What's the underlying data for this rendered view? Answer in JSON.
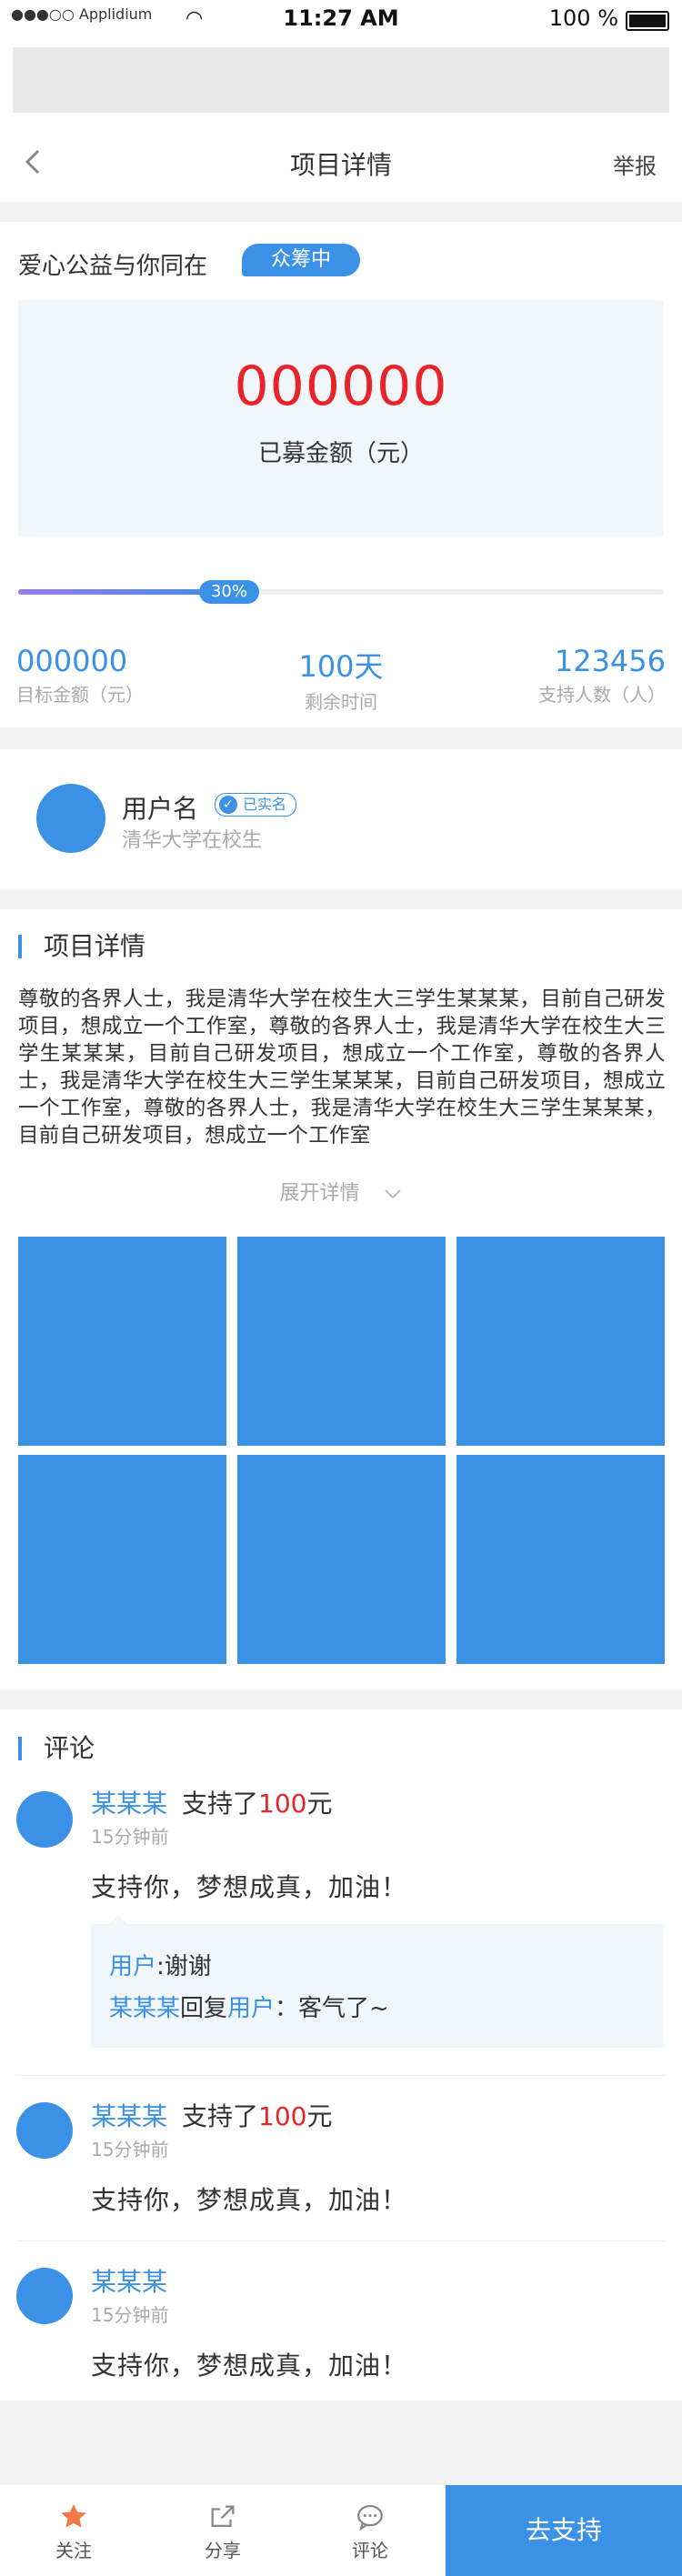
{
  "status_bar": {
    "carrier": "●●●○○ Applidium",
    "time": "11:27 AM",
    "battery": "100 %"
  },
  "nav": {
    "back_icon": "chevron-left-icon",
    "title": "项目详情",
    "report": "举报"
  },
  "project": {
    "slogan": "爱心公益与你同在",
    "status_tag": "众筹中",
    "raised_amount": "000000",
    "raised_label": "已募金额（元）",
    "progress_percent": 30,
    "progress_label": "30%",
    "stats": [
      {
        "value": "000000",
        "label": "目标金额（元）"
      },
      {
        "value": "100天",
        "label": "剩余时间"
      },
      {
        "value": "123456",
        "label": "支持人数（人）"
      }
    ]
  },
  "user": {
    "name": "用户名",
    "verified": "已实名",
    "school": "清华大学在校生"
  },
  "details": {
    "title": "项目详情",
    "text": "尊敬的各界人士，我是清华大学在校生大三学生某某某，目前自己研发项目，想成立一个工作室，尊敬的各界人士，我是清华大学在校生大三学生某某某，目前自己研发项目，想成立一个工作室，尊敬的各界人士，我是清华大学在校生大三学生某某某，目前自己研发项目，想成立一个工作室，尊敬的各界人士，我是清华大学在校生大三学生某某某，目前自己研发项目，想成立一个工作室",
    "expand": "展开详情"
  },
  "comments": {
    "title": "评论",
    "items": [
      {
        "name": "某某某",
        "support_prefix": "支持了",
        "amount": "100",
        "unit": "元",
        "time": "15分钟前",
        "text": "支持你，梦想成真，加油！"
      },
      {
        "name": "某某某",
        "support_prefix": "支持了",
        "amount": "100",
        "unit": "元",
        "time": "15分钟前",
        "text": "支持你，梦想成真，加油！"
      },
      {
        "name": "某某某",
        "time": "15分钟前",
        "text": "支持你，梦想成真，加油！"
      }
    ],
    "reply": {
      "line1_user": "用户",
      "line1_text": ":谢谢",
      "line2_name": "某某某",
      "line2_mid": "回复",
      "line2_user": "用户",
      "line2_text": "：客气了~"
    }
  },
  "tabbar": {
    "items": [
      {
        "label": "关注",
        "icon": "star-icon"
      },
      {
        "label": "分享",
        "icon": "share-icon"
      },
      {
        "label": "评论",
        "icon": "comment-icon"
      }
    ],
    "cta": "去支持"
  },
  "colors": {
    "accent": "#3a91e6",
    "amount_red": "#e8242b"
  }
}
